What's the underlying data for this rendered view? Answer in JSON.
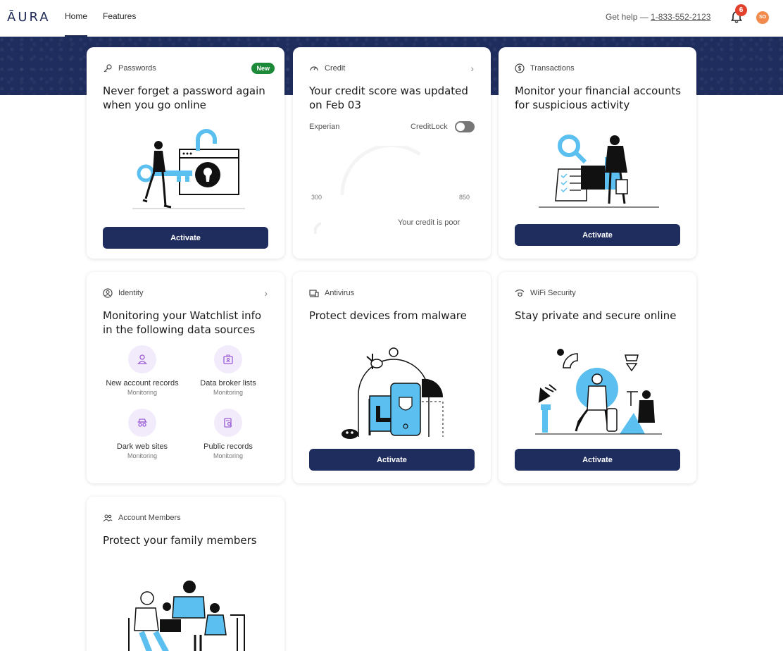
{
  "header": {
    "logo": "ĀURA",
    "tabs": [
      {
        "label": "Home",
        "active": true
      },
      {
        "label": "Features",
        "active": false
      }
    ],
    "help_prefix": "Get help — ",
    "help_phone": "1-833-552-2123",
    "notification_count": "6",
    "avatar_initials": "SO"
  },
  "colors": {
    "brand_navy": "#1f2d5e",
    "new_badge": "#1d8a3a",
    "notification": "#e2412c",
    "avatar": "#f28a4b",
    "accent_blue": "#5bc0f0"
  },
  "cards": {
    "passwords": {
      "label": "Passwords",
      "badge": "New",
      "title": "Never forget a password again when you go online",
      "button": "Activate",
      "icon": "key-icon"
    },
    "credit": {
      "label": "Credit",
      "title": "Your credit score was updated on Feb 03",
      "bureau": "Experian",
      "lock_label": "CreditLock",
      "range_min": "300",
      "range_max": "850",
      "status": "Your credit is poor",
      "icon": "gauge-icon"
    },
    "transactions": {
      "label": "Transactions",
      "title": "Monitor your financial accounts for suspicious activity",
      "button": "Activate",
      "icon": "dollar-icon"
    },
    "identity": {
      "label": "Identity",
      "title": "Monitoring your Watchlist info in the following data sources",
      "icon": "person-icon",
      "sources": [
        {
          "name": "New account records",
          "status": "Monitoring"
        },
        {
          "name": "Data broker lists",
          "status": "Monitoring"
        },
        {
          "name": "Dark web sites",
          "status": "Monitoring"
        },
        {
          "name": "Public records",
          "status": "Monitoring"
        }
      ]
    },
    "antivirus": {
      "label": "Antivirus",
      "title": "Protect devices from malware",
      "button": "Activate",
      "icon": "devices-icon"
    },
    "wifi": {
      "label": "WiFi Security",
      "title": "Stay private and secure online",
      "button": "Activate",
      "icon": "wifi-shield-icon"
    },
    "members": {
      "label": "Account Members",
      "title": "Protect your family members",
      "icon": "people-icon"
    }
  }
}
